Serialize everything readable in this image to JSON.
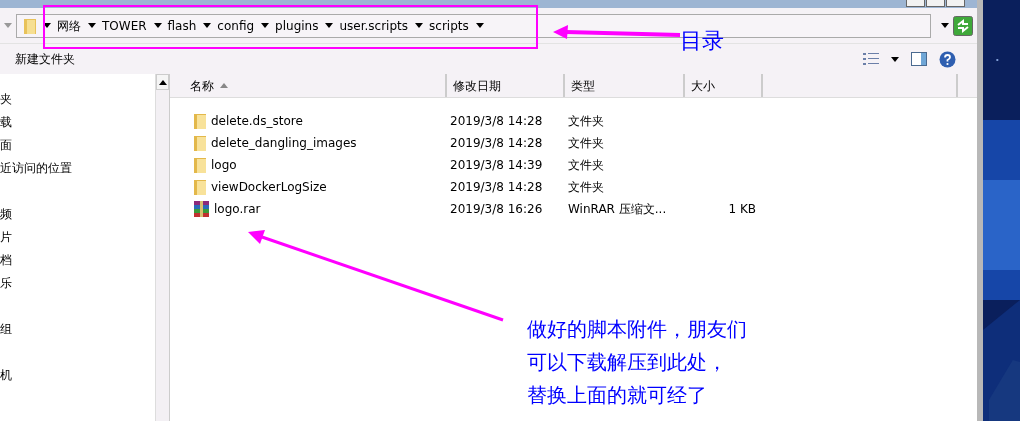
{
  "address_bar": {
    "breadcrumb": [
      {
        "label": "网络"
      },
      {
        "label": "TOWER"
      },
      {
        "label": "flash"
      },
      {
        "label": "config"
      },
      {
        "label": "plugins"
      },
      {
        "label": "user.scripts"
      },
      {
        "label": "scripts"
      }
    ]
  },
  "toolbar": {
    "new_folder": "新建文件夹"
  },
  "sidebar": {
    "groups": [
      {
        "items": [
          {
            "label": "夹"
          },
          {
            "label": "载"
          },
          {
            "label": "面"
          },
          {
            "label": "近访问的位置"
          }
        ]
      },
      {
        "items": [
          {
            "label": "频"
          },
          {
            "label": "片"
          },
          {
            "label": "档"
          },
          {
            "label": "乐"
          }
        ]
      },
      {
        "items": [
          {
            "label": "组"
          }
        ]
      },
      {
        "items": [
          {
            "label": "机"
          }
        ]
      }
    ]
  },
  "table": {
    "columns": [
      {
        "label": "名称",
        "sorted": true
      },
      {
        "label": "修改日期",
        "sorted": false
      },
      {
        "label": "类型",
        "sorted": false
      },
      {
        "label": "大小",
        "sorted": false
      }
    ],
    "rows": [
      {
        "kind": "folder",
        "name": "delete.ds_store",
        "modified": "2019/3/8 14:28",
        "type": "文件夹"
      },
      {
        "kind": "folder",
        "name": "delete_dangling_images",
        "modified": "2019/3/8 14:28",
        "type": "文件夹"
      },
      {
        "kind": "folder",
        "name": "logo",
        "modified": "2019/3/8 14:39",
        "type": "文件夹"
      },
      {
        "kind": "folder",
        "name": "viewDockerLogSize",
        "modified": "2019/3/8 14:28",
        "type": "文件夹"
      },
      {
        "kind": "archive",
        "name": "logo.rar",
        "modified": "2019/3/8 16:26",
        "type": "WinRAR 压缩文...",
        "size": "1 KB"
      }
    ]
  },
  "annotations": {
    "address_label": "目录",
    "note_lines": [
      "做好的脚本附件，朋友们",
      "可以下载解压到此处，",
      "替换上面的就可经了"
    ]
  }
}
